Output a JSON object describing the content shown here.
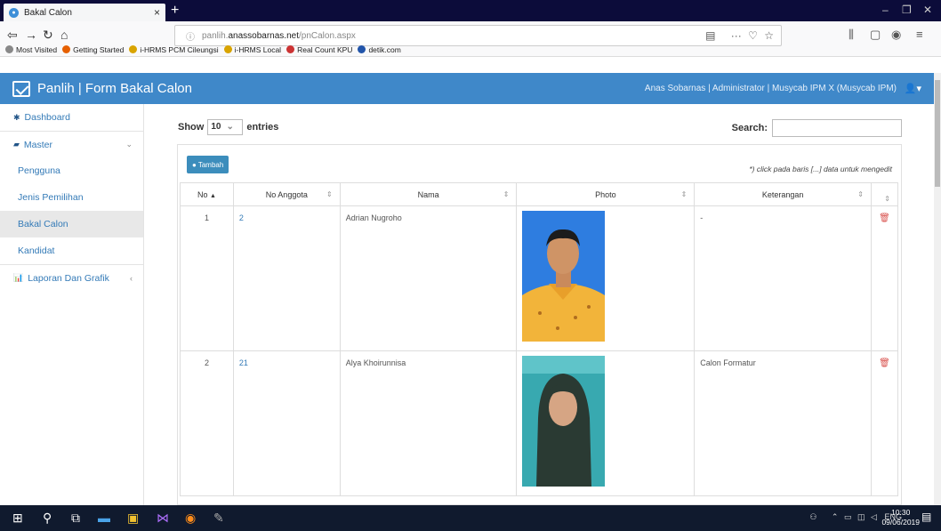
{
  "browser": {
    "tab_title": "Bakal Calon",
    "tab_close": "×",
    "new_tab": "+",
    "url_prefix": "panlih.",
    "url_domain": "anassobarnas.net",
    "url_path": "/pnCalon.aspx",
    "bookmarks": [
      {
        "label": "Most Visited",
        "color": "#888888"
      },
      {
        "label": "Getting Started",
        "color": "#e66000"
      },
      {
        "label": "i-HRMS PCM Cileungsi",
        "color": "#d9a400"
      },
      {
        "label": "i-HRMS Local",
        "color": "#d9a400"
      },
      {
        "label": "Real Count KPU",
        "color": "#cc3333"
      },
      {
        "label": "detik.com",
        "color": "#2255aa"
      }
    ]
  },
  "header": {
    "brand": "Panlih | Form Bakal Calon",
    "user": "Anas Sobarnas | Administrator | Musycab IPM X (Musycab IPM)"
  },
  "sidebar": {
    "dashboard": "Dashboard",
    "master": "Master",
    "pengguna": "Pengguna",
    "jenis": "Jenis Pemilihan",
    "bakal": "Bakal Calon",
    "kandidat": "Kandidat",
    "laporan": "Laporan Dan Grafik"
  },
  "controls": {
    "show": "Show",
    "entries_value": "10",
    "entries": "entries",
    "search": "Search:",
    "tambah": "Tambah",
    "hint": "*) click pada baris [...] data untuk mengedit"
  },
  "table": {
    "headers": [
      "No",
      "No Anggota",
      "Nama",
      "Photo",
      "Keterangan",
      ""
    ],
    "rows": [
      {
        "no": "1",
        "anggota": "2",
        "nama": "Adrian Nugroho",
        "keterangan": "-"
      },
      {
        "no": "2",
        "anggota": "21",
        "nama": "Alya Khoirunnisa",
        "keterangan": "Calon Formatur"
      }
    ]
  },
  "taskbar": {
    "lang": "ENG",
    "time": "10:30",
    "date": "09/06/2019"
  }
}
